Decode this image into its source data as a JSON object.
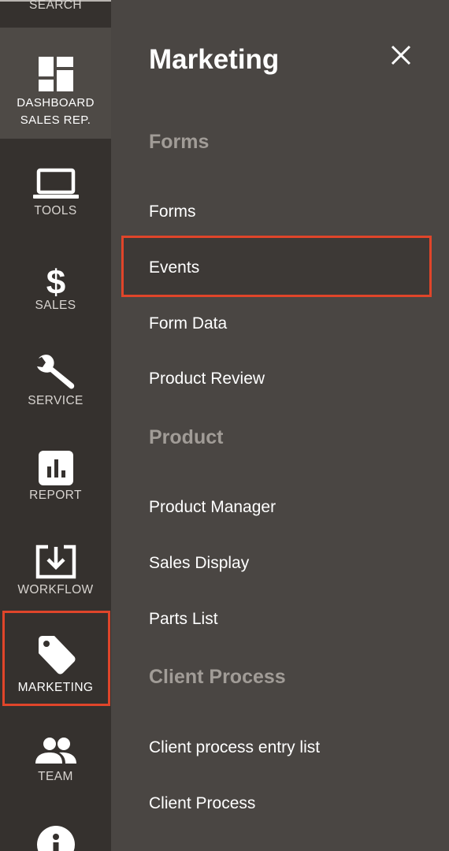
{
  "sidebar": {
    "items": [
      {
        "label": "SEARCH",
        "icon": "search-icon"
      },
      {
        "label_line1": "DASHBOARD",
        "label_line2": "SALES REP.",
        "icon": "dashboard-icon",
        "active": true
      },
      {
        "label": "TOOLS",
        "icon": "laptop-icon"
      },
      {
        "label": "SALES",
        "icon": "dollar-icon"
      },
      {
        "label": "SERVICE",
        "icon": "wrench-icon"
      },
      {
        "label": "REPORT",
        "icon": "bar-chart-icon"
      },
      {
        "label": "WORKFLOW",
        "icon": "download-tray-icon"
      },
      {
        "label": "MARKETING",
        "icon": "tag-icon",
        "highlighted": true
      },
      {
        "label": "TEAM",
        "icon": "team-icon"
      },
      {
        "label": "",
        "icon": "info-icon"
      }
    ]
  },
  "panel": {
    "title": "Marketing",
    "close_icon": "close-icon",
    "sections": [
      {
        "heading": "Forms",
        "links": [
          "Forms",
          "Events",
          "Form Data",
          "Product Review"
        ]
      },
      {
        "heading": "Product",
        "links": [
          "Product Manager",
          "Sales Display",
          "Parts List"
        ]
      },
      {
        "heading": "Client Process",
        "links": [
          "Client process entry list",
          "Client Process"
        ]
      }
    ],
    "highlighted_link": "Events"
  },
  "colors": {
    "rail_bg": "#35312e",
    "panel_bg": "#4a4643",
    "active_rail_bg": "#4e4a46",
    "section_heading": "#a19c97",
    "highlight_border": "#e0452a",
    "text": "#ffffff"
  }
}
